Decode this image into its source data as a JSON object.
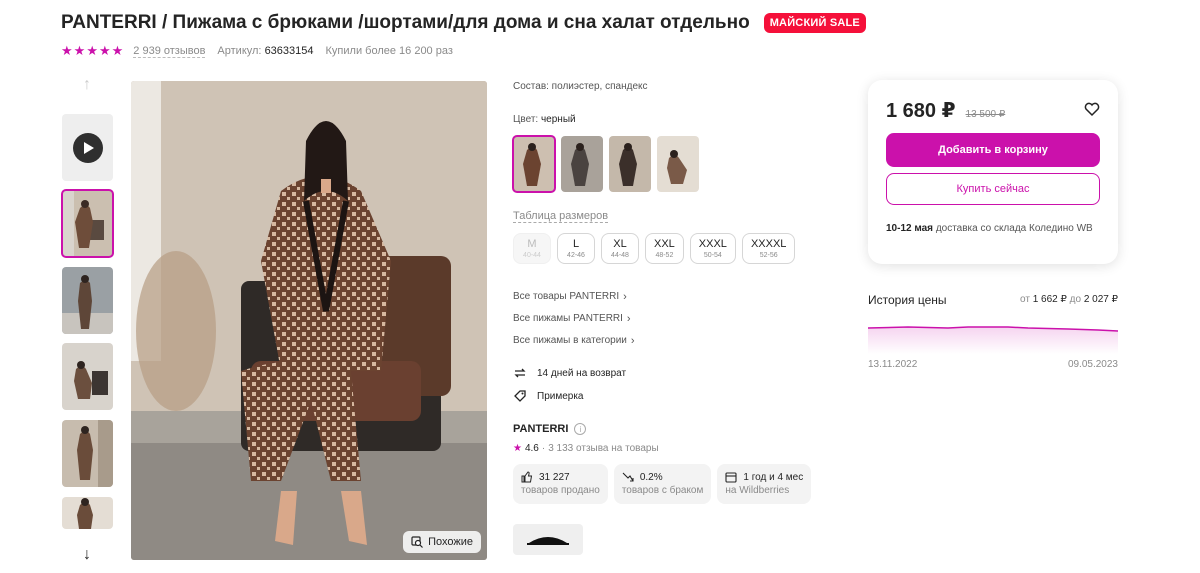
{
  "product": {
    "title": "PANTERRI / Пижама с брюками /шортами/для дома и сна халат отдельно",
    "badge": "МАЙСКИЙ SALE",
    "rating_stars": 5,
    "reviews": "2 939 отзывов",
    "article_label": "Артикул:",
    "article_value": "63633154",
    "bought": "Купили более 16 200 раз"
  },
  "gallery": {
    "similar_label": "Похожие",
    "thumb_count": 5,
    "active_index": 0
  },
  "details": {
    "composition": "Состав: полиэстер, спандекс",
    "color_label": "Цвет:",
    "color_value": "черный",
    "size_table_link": "Таблица размеров",
    "sizes": [
      {
        "name": "M",
        "range": "40-44",
        "disabled": true
      },
      {
        "name": "L",
        "range": "42-46",
        "disabled": false
      },
      {
        "name": "XL",
        "range": "44-48",
        "disabled": false
      },
      {
        "name": "XXL",
        "range": "48-52",
        "disabled": false
      },
      {
        "name": "XXXL",
        "range": "50-54",
        "disabled": false
      },
      {
        "name": "XXXXL",
        "range": "52-56",
        "disabled": false
      }
    ],
    "links": [
      "Все товары PANTERRI",
      "Все пижамы PANTERRI",
      "Все пижамы в категории"
    ],
    "return_text": "14 дней на возврат",
    "fitting_text": "Примерка",
    "brand_name": "PANTERRI",
    "brand_info": "i",
    "brand_rating": "4.6",
    "brand_reviews": "3 133 отзыва на товары",
    "stats": [
      {
        "top": "31 227",
        "bottom": "товаров продано",
        "icon": "thumbs-up-icon"
      },
      {
        "top": "0.2%",
        "bottom": "товаров с браком",
        "icon": "trend-down-icon"
      },
      {
        "top": "1 год и 4 мес",
        "bottom": "на Wildberries",
        "icon": "calendar-icon"
      }
    ]
  },
  "buy": {
    "price": "1 680 ₽",
    "old_price": "13 500 ₽",
    "add_to_cart": "Добавить в корзину",
    "buy_now": "Купить сейчас",
    "delivery_date": "10-12 мая",
    "delivery_text": "доставка со склада Коледино WB"
  },
  "price_history": {
    "title": "История цены",
    "range_from_label": "от",
    "range_from": "1 662 ₽",
    "range_to_label": "до",
    "range_to": "2 027 ₽",
    "date_start": "13.11.2022",
    "date_end": "09.05.2023"
  },
  "colors": {
    "accent": "#cb11ab",
    "sale": "#f5103a"
  }
}
